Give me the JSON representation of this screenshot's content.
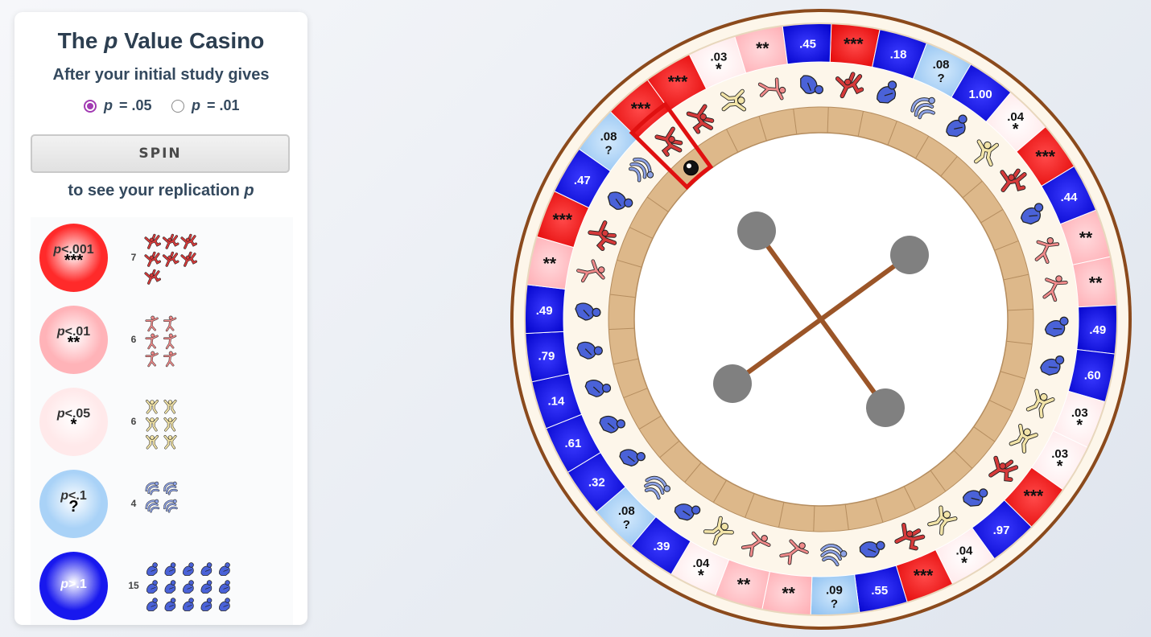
{
  "panel": {
    "title_pre": "The ",
    "title_p": "p",
    "title_post": " Value Casino",
    "subtitle": "After your initial study gives",
    "radio1": {
      "p": "p",
      "label": "= .05",
      "checked": true
    },
    "radio2": {
      "p": "p",
      "label": "= .01",
      "checked": false
    },
    "spin_label": "SPIN",
    "after_text": "to see your replication ",
    "after_p": "p"
  },
  "legend": [
    {
      "label": "<.001",
      "stars": "***",
      "count": "7",
      "ball_color": "#ff2a2a",
      "figure": "red-diver-icon",
      "fig_color": "#d63a3a"
    },
    {
      "label": "<.01",
      "stars": "**",
      "count": "6",
      "ball_color": "#ffb3b8",
      "figure": "pink-jumper-icon",
      "fig_color": "#f08a8a"
    },
    {
      "label": "<.05",
      "stars": "*",
      "count": "6",
      "ball_color": "#ffe9ea",
      "figure": "yellow-climber-icon",
      "fig_color": "#f2e4a8"
    },
    {
      "label": "<.1",
      "stars": "?",
      "count": "4",
      "ball_color": "#a9d2f7",
      "figure": "blue-falling-icon",
      "fig_color": "#8ea3e6"
    },
    {
      "label": ">.1",
      "stars": "",
      "count": "15",
      "ball_color": "#1818ee",
      "figure": "crouching-person-icon",
      "fig_color": "#4a62d8"
    }
  ],
  "colors": {
    "p001": "#ff2020",
    "p01": "#ffc2c6",
    "p05": "#fff0f0",
    "p1": "#a9d2f7",
    "ns": "#1a1ae6",
    "wheel_rim": "#8b4a1c",
    "track": "#ddb88a",
    "selected": "#e01010"
  },
  "wheel": {
    "pockets": [
      {
        "top": "***",
        "bottom": ""
      },
      {
        "top": ".18",
        "bottom": ""
      },
      {
        "top": ".08",
        "bottom": "?"
      },
      {
        "top": "1.00",
        "bottom": ""
      },
      {
        "top": ".04",
        "bottom": "*"
      },
      {
        "top": "***",
        "bottom": ""
      },
      {
        "top": ".44",
        "bottom": ""
      },
      {
        "top": "**",
        "bottom": ""
      },
      {
        "top": "**",
        "bottom": ""
      },
      {
        "top": ".49",
        "bottom": ""
      },
      {
        "top": ".60",
        "bottom": ""
      },
      {
        "top": ".03",
        "bottom": "*"
      },
      {
        "top": ".03",
        "bottom": "*"
      },
      {
        "top": "***",
        "bottom": ""
      },
      {
        "top": ".97",
        "bottom": ""
      },
      {
        "top": ".04",
        "bottom": "*"
      },
      {
        "top": "***",
        "bottom": ""
      },
      {
        "top": ".55",
        "bottom": ""
      },
      {
        "top": ".09",
        "bottom": "?"
      },
      {
        "top": "**",
        "bottom": ""
      },
      {
        "top": "**",
        "bottom": ""
      },
      {
        "top": ".04",
        "bottom": "*"
      },
      {
        "top": ".39",
        "bottom": ""
      },
      {
        "top": ".08",
        "bottom": "?"
      },
      {
        "top": ".32",
        "bottom": ""
      },
      {
        "top": ".61",
        "bottom": ""
      },
      {
        "top": ".14",
        "bottom": ""
      },
      {
        "top": ".79",
        "bottom": ""
      },
      {
        "top": ".49",
        "bottom": ""
      },
      {
        "top": "**",
        "bottom": ""
      },
      {
        "top": "***",
        "bottom": ""
      },
      {
        "top": ".47",
        "bottom": ""
      },
      {
        "top": ".08",
        "bottom": "?"
      },
      {
        "top": "***",
        "bottom": ""
      },
      {
        "top": "***",
        "bottom": ""
      },
      {
        "top": ".03",
        "bottom": "*"
      },
      {
        "top": "**",
        "bottom": ""
      },
      {
        "top": ".45",
        "bottom": ""
      }
    ],
    "selected_pocket": 33
  }
}
